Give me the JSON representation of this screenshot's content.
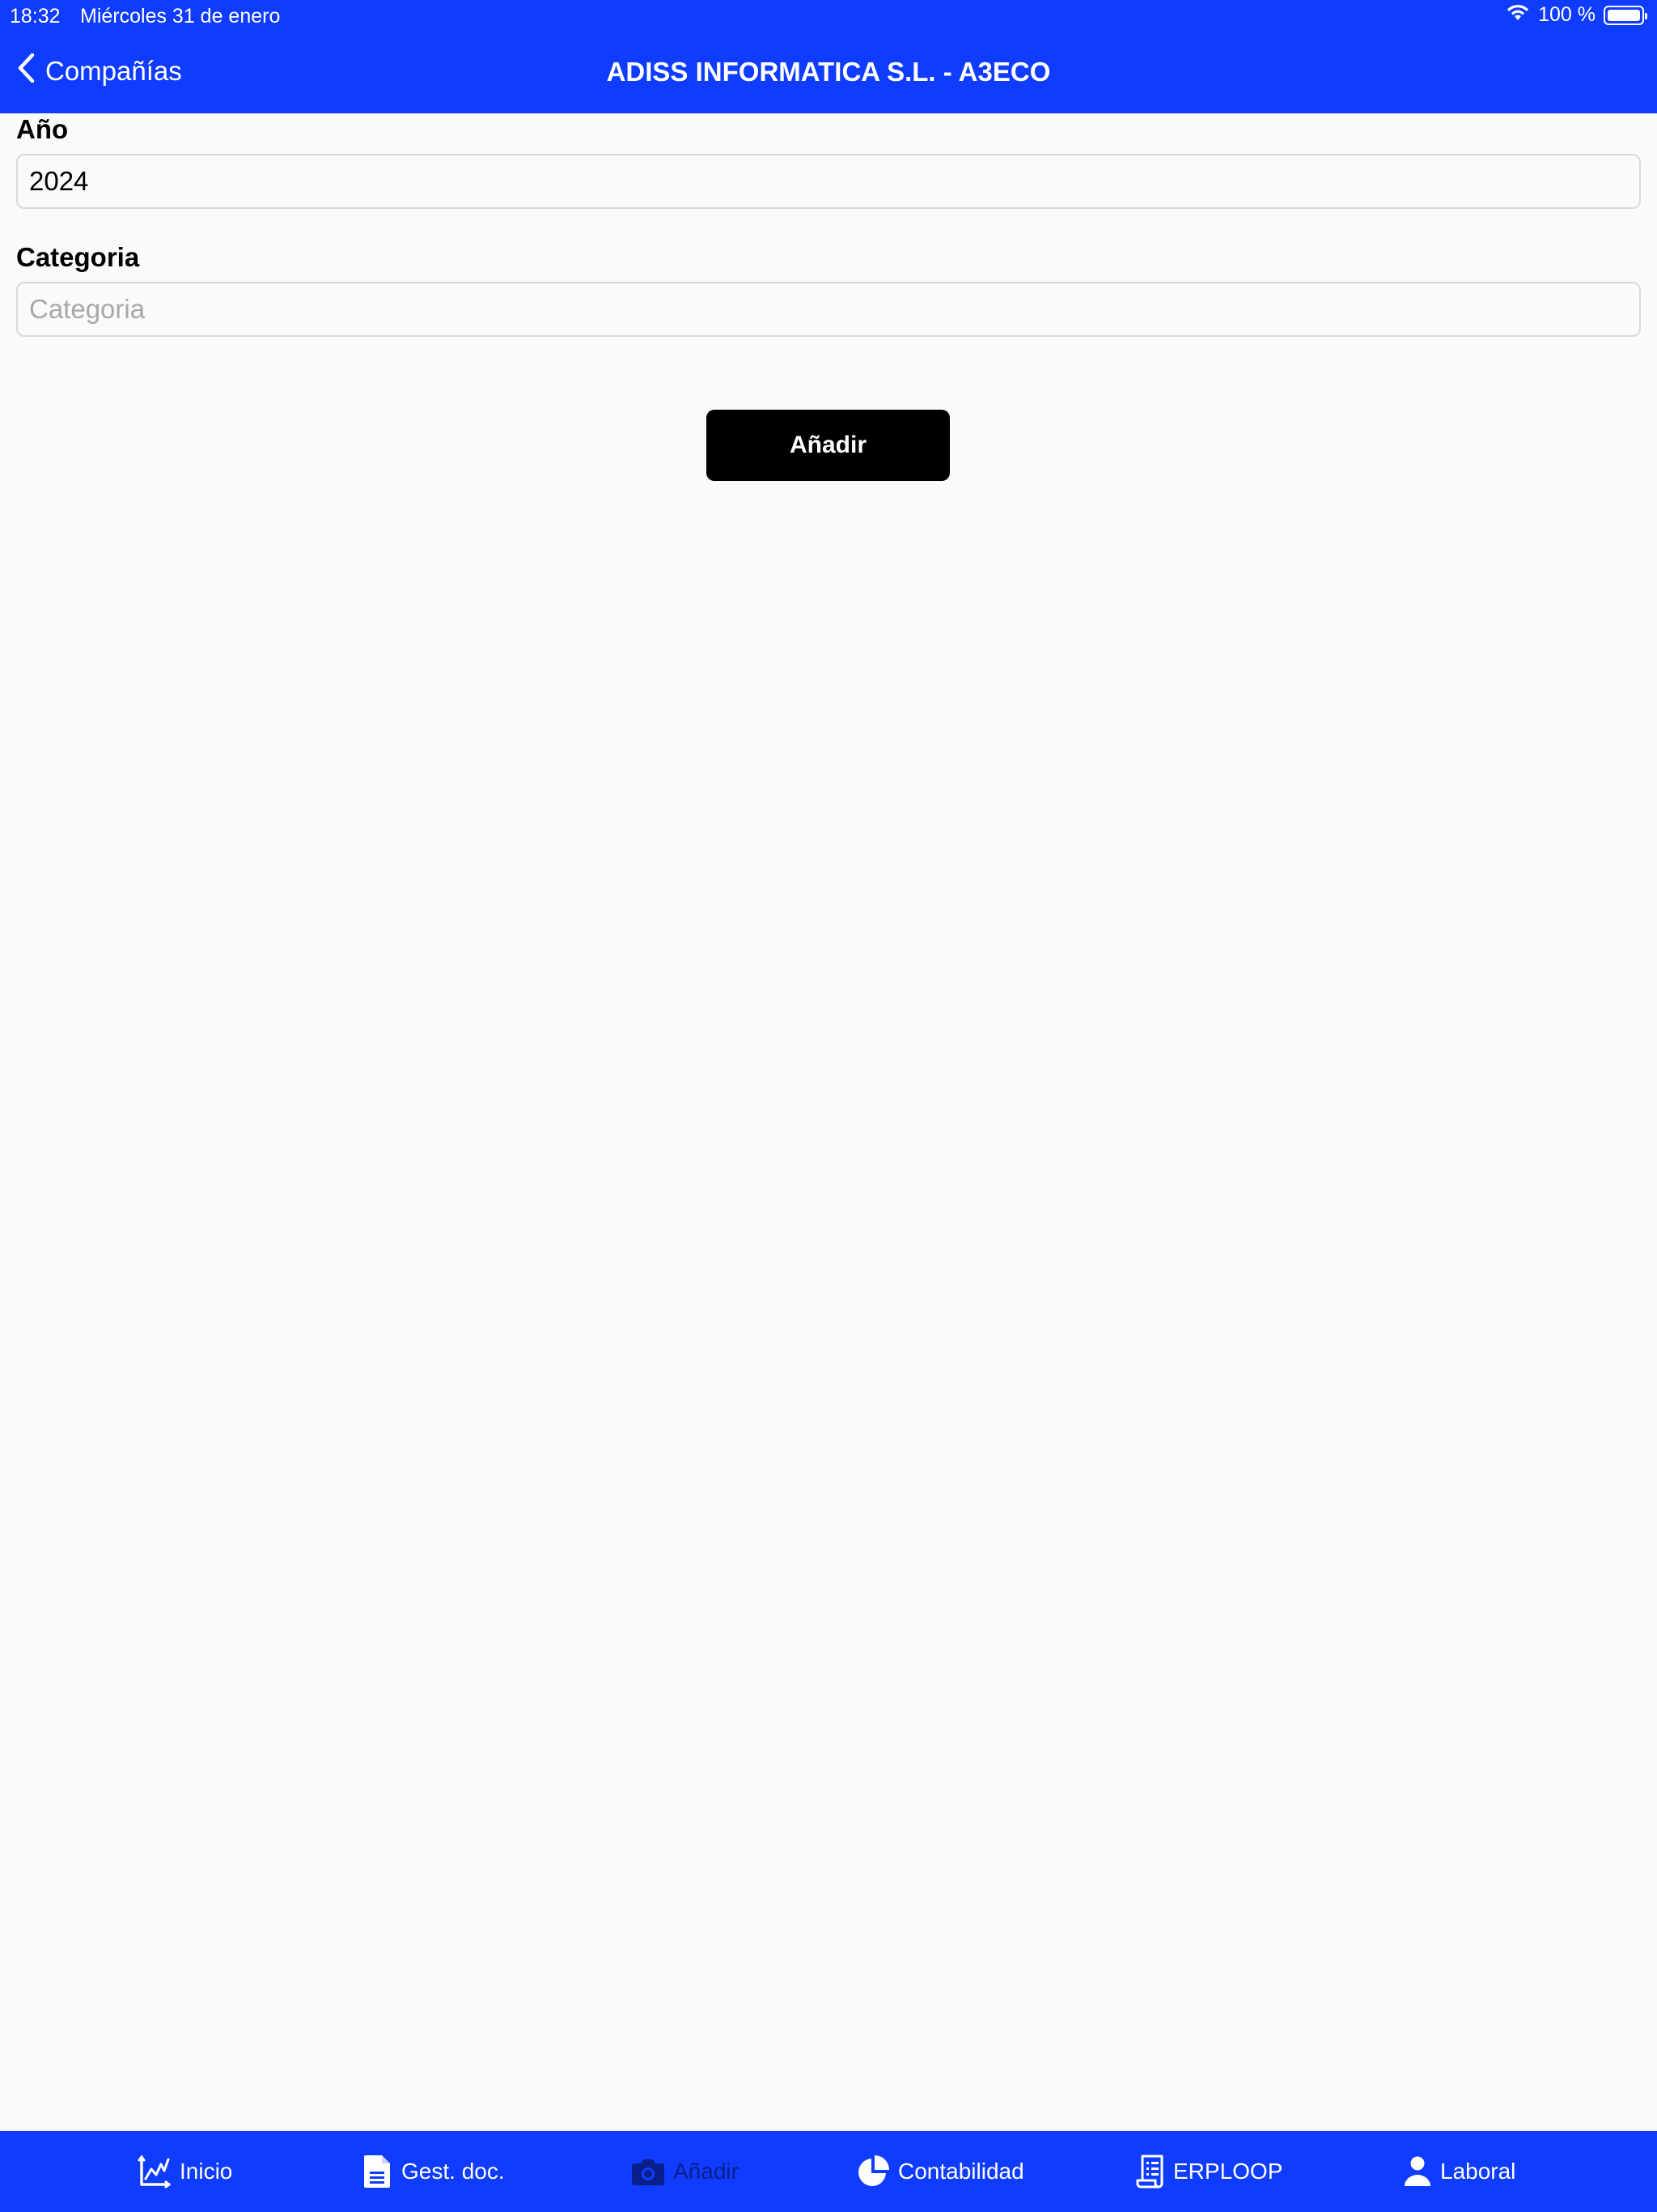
{
  "status_bar": {
    "time": "18:32",
    "date": "Miércoles 31 de enero",
    "battery": "100 %"
  },
  "nav": {
    "back_label": "Compañías",
    "title": "ADISS INFORMATICA S.L. - A3ECO"
  },
  "form": {
    "year_label": "Año",
    "year_value": "2024",
    "category_label": "Categoria",
    "category_placeholder": "Categoria",
    "add_button": "Añadir"
  },
  "tabs": [
    {
      "label": "Inicio",
      "icon": "chart-icon"
    },
    {
      "label": "Gest. doc.",
      "icon": "document-icon"
    },
    {
      "label": "Añadir",
      "icon": "camera-icon",
      "active": true
    },
    {
      "label": "Contabilidad",
      "icon": "pie-chart-icon"
    },
    {
      "label": "ERPLOOP",
      "icon": "receipt-icon"
    },
    {
      "label": "Laboral",
      "icon": "person-icon"
    }
  ],
  "colors": {
    "brand": "#0f3cff",
    "active_tab": "#0a1f8a",
    "button": "#000000"
  }
}
